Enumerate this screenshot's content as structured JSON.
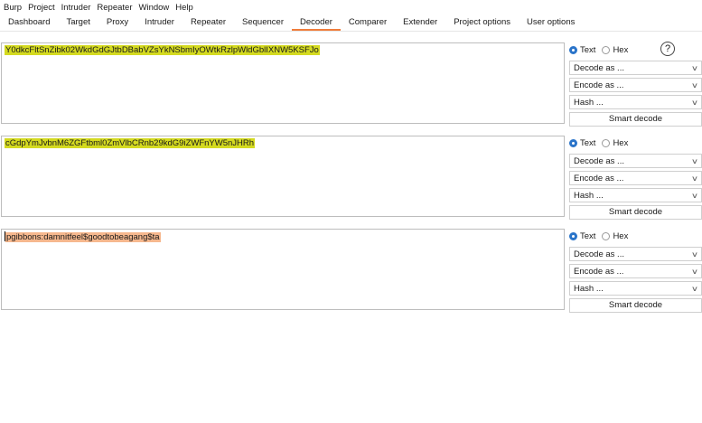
{
  "menubar": {
    "items": [
      "Burp",
      "Project",
      "Intruder",
      "Repeater",
      "Window",
      "Help"
    ]
  },
  "tabs": [
    {
      "label": "Dashboard"
    },
    {
      "label": "Target"
    },
    {
      "label": "Proxy"
    },
    {
      "label": "Intruder"
    },
    {
      "label": "Repeater"
    },
    {
      "label": "Sequencer"
    },
    {
      "label": "Decoder"
    },
    {
      "label": "Comparer"
    },
    {
      "label": "Extender"
    },
    {
      "label": "Project options"
    },
    {
      "label": "User options"
    }
  ],
  "active_tab": "Decoder",
  "panes": [
    {
      "text": "Y0dkcFltSnZibk02WkdGdGJtbDBabVZsYkNSbmIyOWtkRzlpWldGblIXNW5KSFJo",
      "highlight": "#d4da20",
      "controls": {
        "text_label": "Text",
        "hex_label": "Hex",
        "decode": "Decode as ...",
        "encode": "Encode as ...",
        "hash": "Hash ...",
        "smart": "Smart decode"
      }
    },
    {
      "text": "cGdpYmJvbnM6ZGFtbml0ZmVlbCRnb29kdG9iZWFnYW5nJHRh",
      "highlight": "#d4da20",
      "controls": {
        "text_label": "Text",
        "hex_label": "Hex",
        "decode": "Decode as ...",
        "encode": "Encode as ...",
        "hash": "Hash ...",
        "smart": "Smart decode"
      }
    },
    {
      "text": "pgibbons:damnitfeel$goodtobeagang$ta",
      "highlight": "#f6b88e",
      "controls": {
        "text_label": "Text",
        "hex_label": "Hex",
        "decode": "Decode as ...",
        "encode": "Encode as ...",
        "hash": "Hash ...",
        "smart": "Smart decode"
      }
    }
  ],
  "colors": {
    "accent_orange": "#f07d3b",
    "radio_blue": "#2a74c9"
  },
  "icons": {
    "help": "question-circle-icon",
    "dropdown": "chevron-down-icon"
  },
  "help_glyph": "?",
  "chevron_glyph": "∨"
}
